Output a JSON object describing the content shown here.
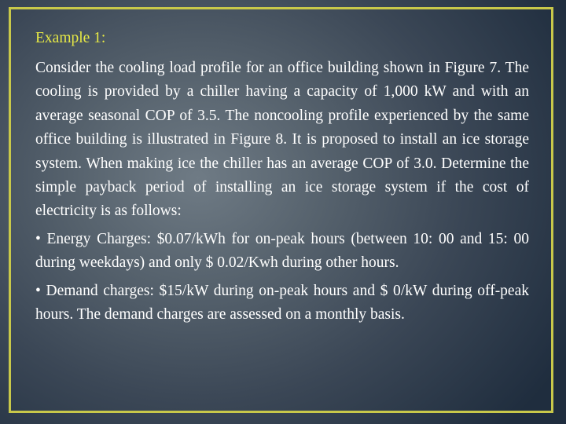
{
  "slide": {
    "heading": "Example 1:",
    "paragraph": "Consider the cooling load profile for an office building shown in Figure 7. The cooling is provided by a chiller having a capacity of 1,000 kW and with an average seasonal COP of 3.5. The noncooling profile experienced by the same office building is illustrated in Figure 8. It is proposed to install an ice storage system. When making ice the chiller has an average COP of 3.0. Determine the simple payback period of installing an ice storage system if the cost of electricity is as follows:",
    "bullets": [
      "• Energy Charges: $0.07/kWh for on-peak hours (between 10: 00 and 15: 00 during weekdays) and only $ 0.02/Kwh during other hours.",
      "• Demand charges: $15/kW during on-peak hours and $ 0/kW during off-peak hours. The demand charges are assessed on a monthly basis."
    ]
  },
  "colors": {
    "heading": "#e6e845",
    "body_text": "#ffffff",
    "frame_border": "#c8c84a",
    "background_center": "#6f7b85",
    "background_edge": "#1f2d3e"
  }
}
